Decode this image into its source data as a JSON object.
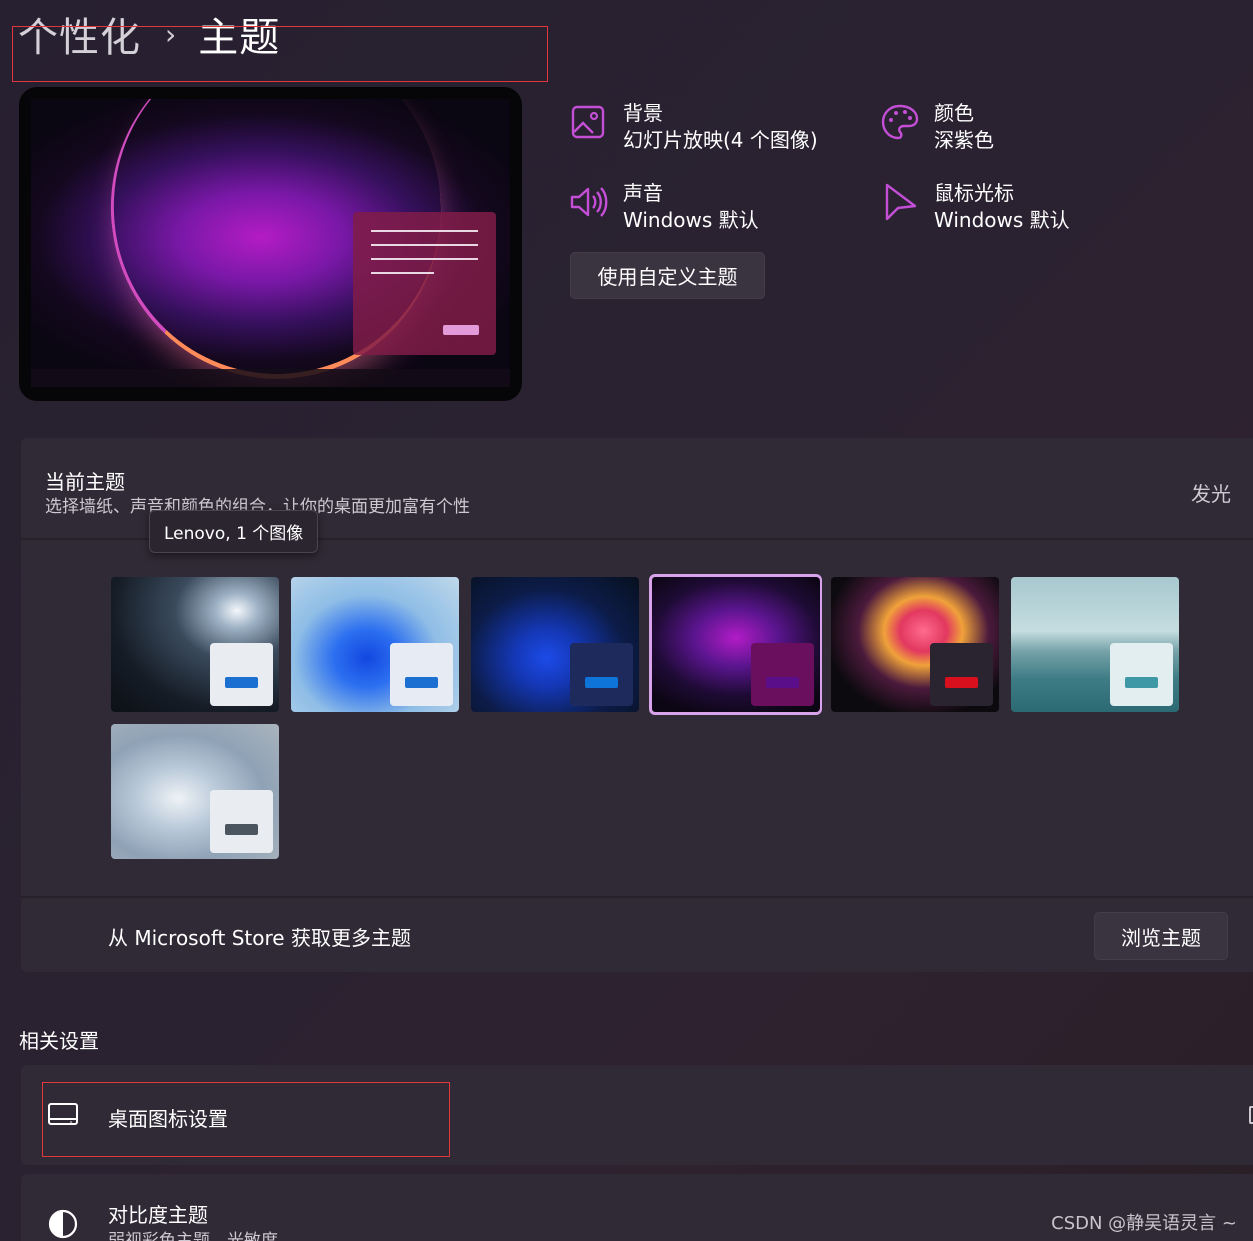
{
  "breadcrumb": {
    "parent": "个性化",
    "separator": "›",
    "current": "主题"
  },
  "preview": {
    "label": "theme-preview"
  },
  "properties": {
    "background": {
      "title": "背景",
      "value": "幻灯片放映(4 个图像)",
      "icon": "image-icon"
    },
    "color": {
      "title": "颜色",
      "value": "深紫色",
      "icon": "palette-icon"
    },
    "sound": {
      "title": "声音",
      "value": "Windows 默认",
      "icon": "speaker-icon"
    },
    "cursor": {
      "title": "鼠标光标",
      "value": "Windows 默认",
      "icon": "cursor-icon"
    }
  },
  "custom_theme_button": "使用自定义主题",
  "current_theme": {
    "title": "当前主题",
    "subtitle": "选择墙纸、声音和颜色的组合，让你的桌面更加富有个性",
    "current_name": "发光",
    "tooltip": "Lenovo, 1 个图像",
    "themes": [
      {
        "name": "theme-1",
        "accent": "#1a6fd0",
        "selected": false
      },
      {
        "name": "theme-2",
        "accent": "#1a6fd0",
        "selected": false
      },
      {
        "name": "theme-3",
        "accent": "#0e74d9",
        "selected": false
      },
      {
        "name": "theme-4",
        "accent": "#5a0e8a",
        "selected": true
      },
      {
        "name": "theme-5",
        "accent": "#d80f1c",
        "selected": false
      },
      {
        "name": "theme-6",
        "accent": "#3f98a6",
        "selected": false
      },
      {
        "name": "theme-7",
        "accent": "#4b5560",
        "selected": false
      }
    ],
    "store_text": "从 Microsoft Store 获取更多主题",
    "browse_button": "浏览主题"
  },
  "related": {
    "heading": "相关设置",
    "desktop_icons": {
      "title": "桌面图标设置",
      "icon": "monitor-icon"
    },
    "contrast": {
      "title": "对比度主题",
      "subtitle": "弱视彩色主题，光敏度",
      "icon": "contrast-icon"
    }
  },
  "watermark": "CSDN @静吴语灵言 ~",
  "colors": {
    "accent": "#c44fd6",
    "selection": "#d8a3ea",
    "annotation": "#e0363c"
  }
}
